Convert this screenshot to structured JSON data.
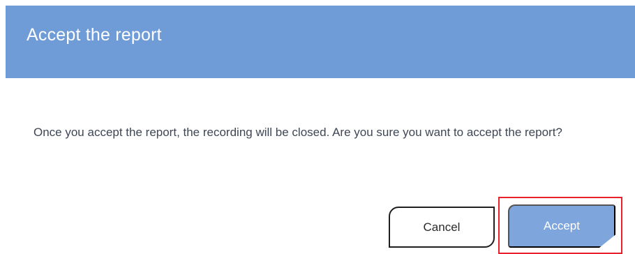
{
  "dialog": {
    "title": "Accept the report",
    "message": "Once you accept the report, the recording will be closed. Are you sure you want to accept the report?",
    "buttons": {
      "cancel_label": "Cancel",
      "accept_label": "Accept"
    }
  },
  "colors": {
    "header_background": "#6f9bd6",
    "accept_button": "#7ea6dc",
    "highlight_border": "#e8212a",
    "body_text": "#3e4654"
  }
}
